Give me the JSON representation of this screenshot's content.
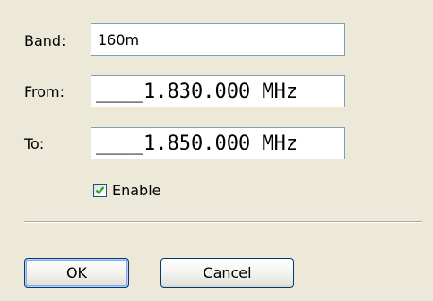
{
  "form": {
    "band_label": "Band:",
    "band_value": "160m",
    "from_label": "From:",
    "from_value": "____1.830.000 MHz",
    "to_label": "To:",
    "to_value": "____1.850.000 MHz",
    "enable_label": "Enable",
    "enable_checked": true
  },
  "buttons": {
    "ok_label": "OK",
    "cancel_label": "Cancel"
  },
  "colors": {
    "background": "#ece9d8",
    "field_border": "#7f9db9",
    "button_border": "#003c74",
    "check_mark": "#21a121"
  }
}
